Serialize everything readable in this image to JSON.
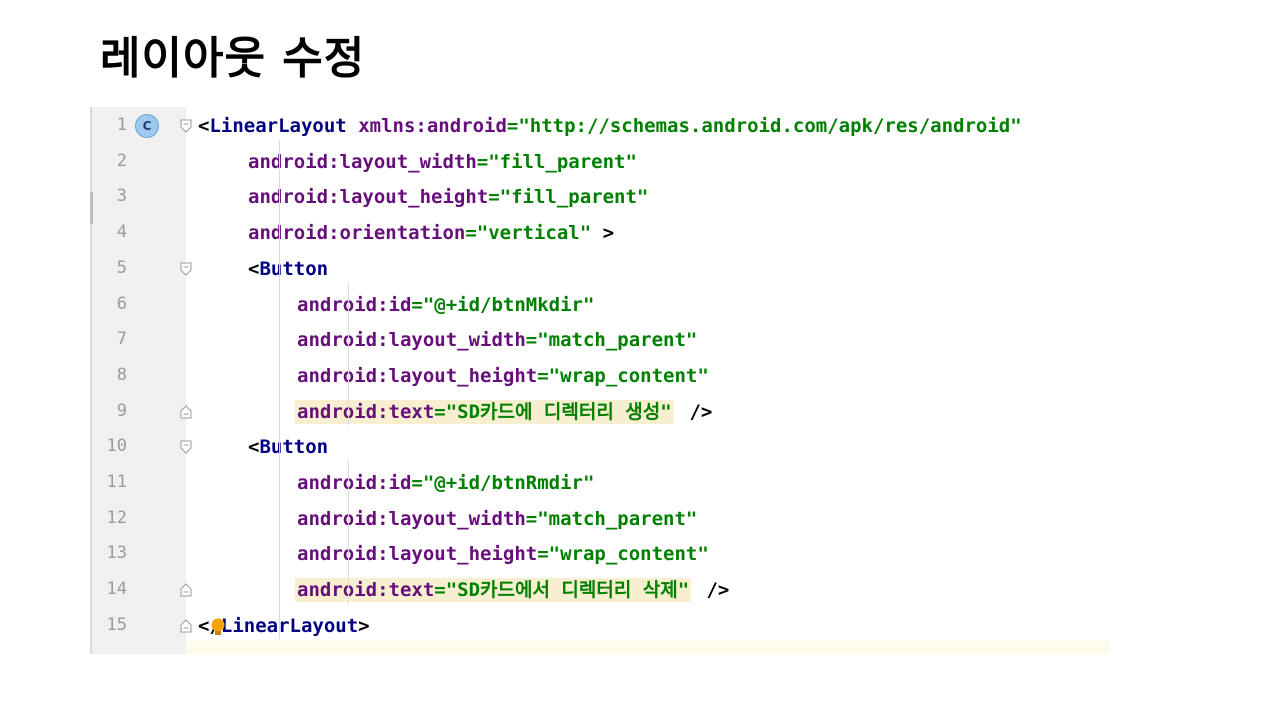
{
  "slide": {
    "title": "레이아웃 수정"
  },
  "editor": {
    "lines": [
      {
        "num": "1",
        "indent": 0,
        "segments": [
          {
            "t": "<",
            "c": "br"
          },
          {
            "t": "LinearLayout",
            "c": "tag"
          },
          {
            "t": " ",
            "c": "br"
          },
          {
            "t": "xmlns:",
            "c": "ns"
          },
          {
            "t": "android",
            "c": "ns"
          },
          {
            "t": "=\"http://schemas.android.com/apk/res/android\"",
            "c": "val"
          }
        ]
      },
      {
        "num": "2",
        "indent": 1,
        "segments": [
          {
            "t": "android:layout_width",
            "c": "attr"
          },
          {
            "t": "=\"fill_parent\"",
            "c": "val"
          }
        ]
      },
      {
        "num": "3",
        "indent": 1,
        "segments": [
          {
            "t": "android:layout_height",
            "c": "attr"
          },
          {
            "t": "=\"fill_parent\"",
            "c": "val"
          }
        ]
      },
      {
        "num": "4",
        "indent": 1,
        "segments": [
          {
            "t": "android:orientation",
            "c": "attr"
          },
          {
            "t": "=\"vertical\"",
            "c": "val"
          },
          {
            "t": " >",
            "c": "br"
          }
        ]
      },
      {
        "num": "5",
        "indent": 1,
        "segments": [
          {
            "t": "<",
            "c": "br"
          },
          {
            "t": "Button",
            "c": "tag"
          }
        ]
      },
      {
        "num": "6",
        "indent": 2,
        "segments": [
          {
            "t": "android:id",
            "c": "attr"
          },
          {
            "t": "=\"@+id/btnMkdir\"",
            "c": "val"
          }
        ]
      },
      {
        "num": "7",
        "indent": 2,
        "segments": [
          {
            "t": "android:layout_width",
            "c": "attr"
          },
          {
            "t": "=\"match_parent\"",
            "c": "val"
          }
        ]
      },
      {
        "num": "8",
        "indent": 2,
        "segments": [
          {
            "t": "android:layout_height",
            "c": "attr"
          },
          {
            "t": "=\"wrap_content\"",
            "c": "val"
          }
        ]
      },
      {
        "num": "9",
        "indent": 2,
        "hl": true,
        "segments": [
          {
            "t": "android:text",
            "c": "attr"
          },
          {
            "t": "=\"SD카드에 디렉터리 생성\"",
            "c": "val"
          }
        ],
        "tail": " />"
      },
      {
        "num": "10",
        "indent": 1,
        "segments": [
          {
            "t": "<",
            "c": "br"
          },
          {
            "t": "Button",
            "c": "tag"
          }
        ]
      },
      {
        "num": "11",
        "indent": 2,
        "segments": [
          {
            "t": "android:id",
            "c": "attr"
          },
          {
            "t": "=\"@+id/btnRmdir\"",
            "c": "val"
          }
        ]
      },
      {
        "num": "12",
        "indent": 2,
        "segments": [
          {
            "t": "android:layout_width",
            "c": "attr"
          },
          {
            "t": "=\"match_parent\"",
            "c": "val"
          }
        ]
      },
      {
        "num": "13",
        "indent": 2,
        "segments": [
          {
            "t": "android:layout_height",
            "c": "attr"
          },
          {
            "t": "=\"wrap_content\"",
            "c": "val"
          }
        ]
      },
      {
        "num": "14",
        "indent": 2,
        "hl": true,
        "segments": [
          {
            "t": "android:text",
            "c": "attr"
          },
          {
            "t": "=\"SD카드에서 디렉터리 삭제\"",
            "c": "val"
          }
        ],
        "tail": " />"
      },
      {
        "num": "15",
        "indent": 0,
        "segments": [
          {
            "t": "</",
            "c": "br"
          },
          {
            "t": "LinearLayout",
            "c": "tag"
          },
          {
            "t": ">",
            "c": "br"
          }
        ]
      }
    ],
    "class_badge": "C",
    "colors": {
      "tag": "#000080",
      "attribute": "#660e7a",
      "value": "#008000",
      "highlight": "#f7efcf",
      "gutter": "#f0f0f0",
      "line_number": "#9a9a9a"
    },
    "icons": [
      "class-c-icon",
      "fold-marker-icon",
      "intention-bulb-icon"
    ]
  }
}
